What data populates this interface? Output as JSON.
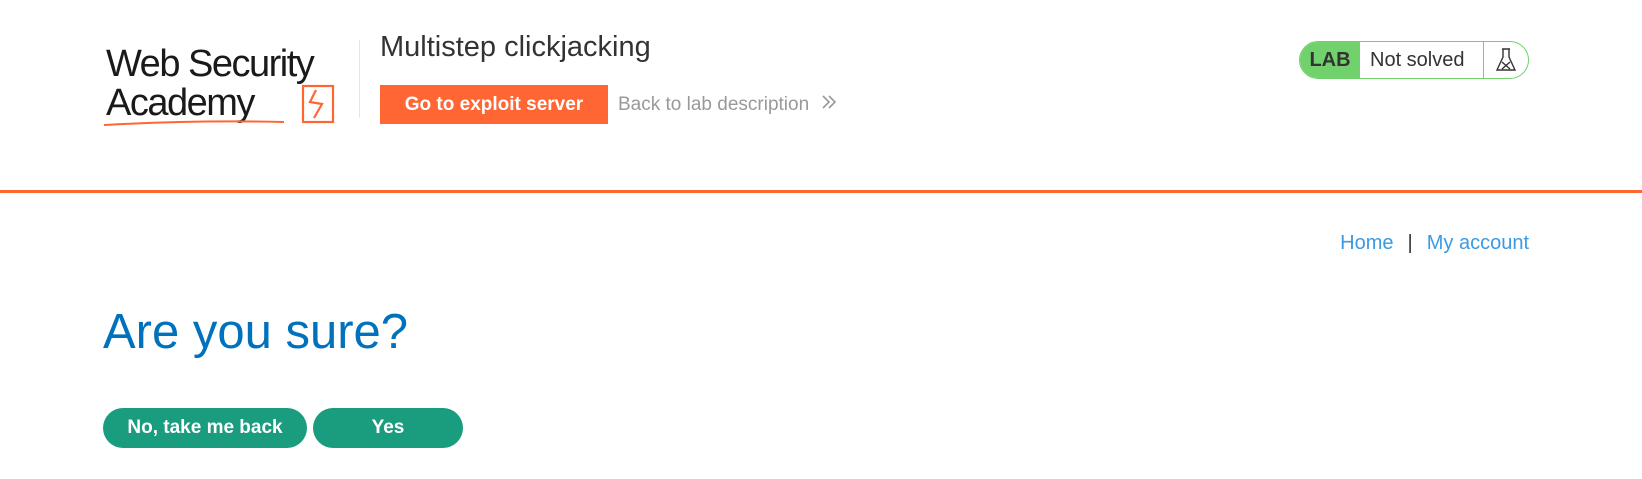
{
  "header": {
    "logo_text": [
      "Web Security",
      "Academy"
    ],
    "lab_title": "Multistep clickjacking",
    "exploit_button": "Go to exploit server",
    "back_link": "Back to lab description",
    "lab_status": {
      "badge": "LAB",
      "status_text": "Not solved",
      "icon": "flask-icon"
    }
  },
  "nav": {
    "home": "Home",
    "separator": "|",
    "account": "My account"
  },
  "main": {
    "heading": "Are you sure?",
    "buttons": {
      "back": "No, take me back",
      "yes": "Yes"
    }
  },
  "colors": {
    "brand_orange": "#ff6633",
    "status_green": "#70d16d",
    "heading_blue": "#0071bc",
    "link_blue": "#3b9ae1",
    "button_teal": "#1a9c7e"
  }
}
